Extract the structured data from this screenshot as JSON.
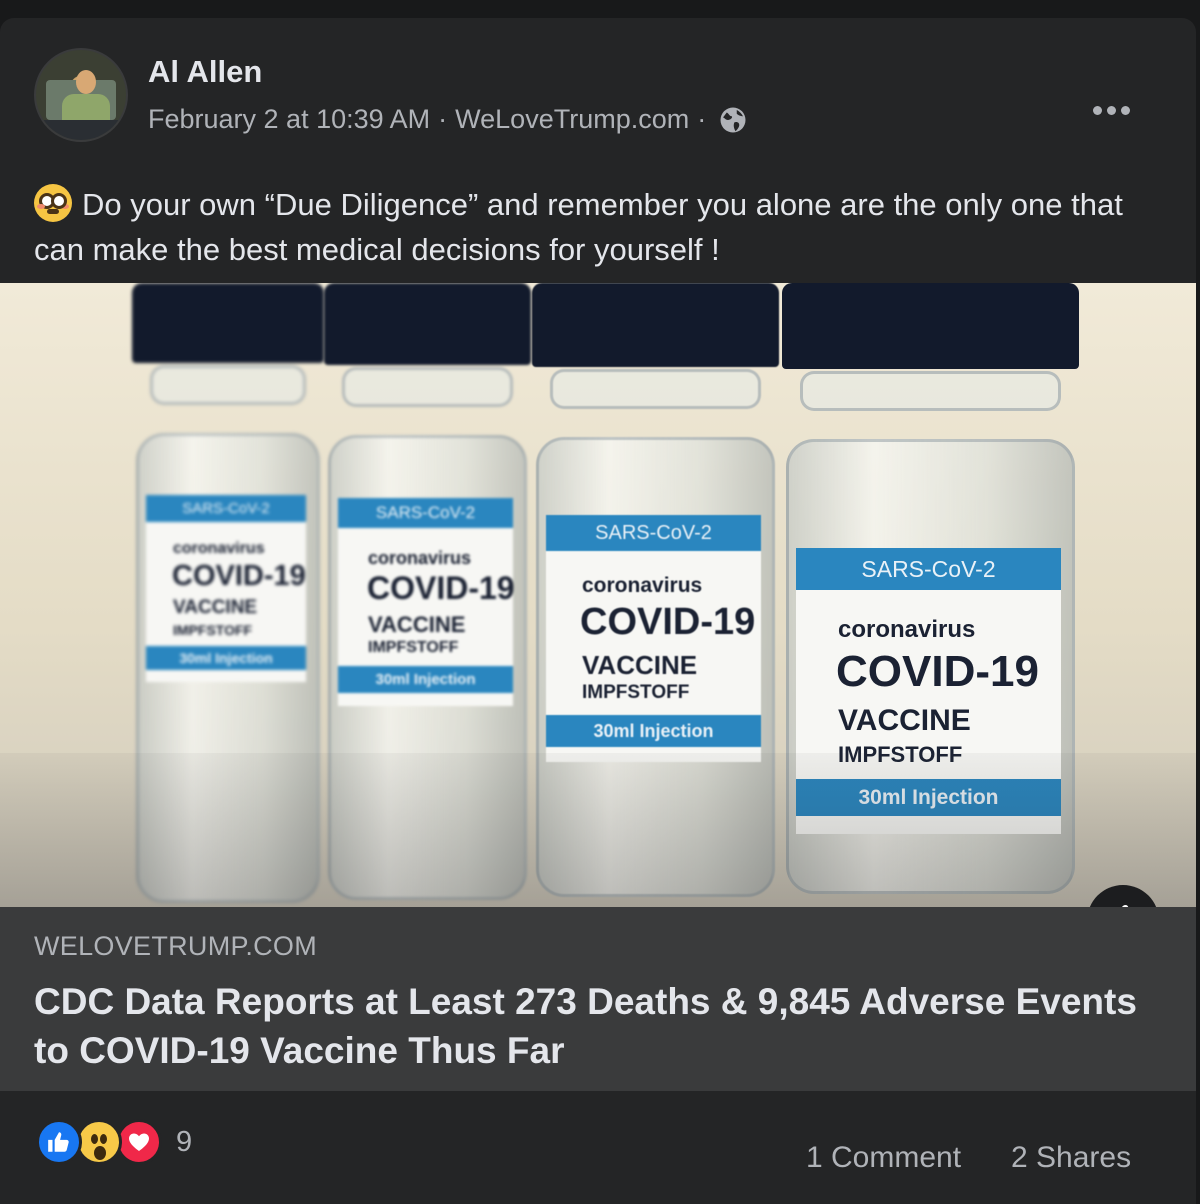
{
  "post": {
    "author": "Al Allen",
    "timestamp": "February 2 at 10:39 AM",
    "via": "WeLoveTrump.com",
    "separator": "·",
    "privacy_icon": "globe-icon",
    "more_icon": "more-horizontal-icon",
    "text": "Do your own “Due Diligence” and remember you alone are the only one that can make the best medical decisions for yourself !",
    "text_emoji": "flushed-face-icon"
  },
  "link_preview": {
    "image": {
      "vial_labels": {
        "top": "SARS-CoV-2",
        "line1": "coronavirus",
        "line2": "COVID-19",
        "line3": "VACCINE",
        "line4": "IMPFSTOFF",
        "bottom": "30ml  Injection"
      },
      "colors": {
        "cap": "#121a2c",
        "band": "#2a86bf"
      }
    },
    "info_icon": "info-icon",
    "domain": "WELOVETRUMP.COM",
    "title": "CDC Data Reports at Least 273 Deaths & 9,845 Adverse Events to COVID-19 Vaccine Thus Far"
  },
  "footer": {
    "reaction_icons": [
      "like-icon",
      "wow-icon",
      "love-icon"
    ],
    "reaction_count": "9",
    "comments": "1 Comment",
    "shares": "2 Shares"
  },
  "colors": {
    "background": "#18191a",
    "card": "#242526",
    "link_box": "#3a3b3c",
    "primary_text": "#e4e6eb",
    "secondary_text": "#b0b3b8",
    "like": "#1877f2",
    "love": "#f02849",
    "wow": "#f7c948"
  }
}
